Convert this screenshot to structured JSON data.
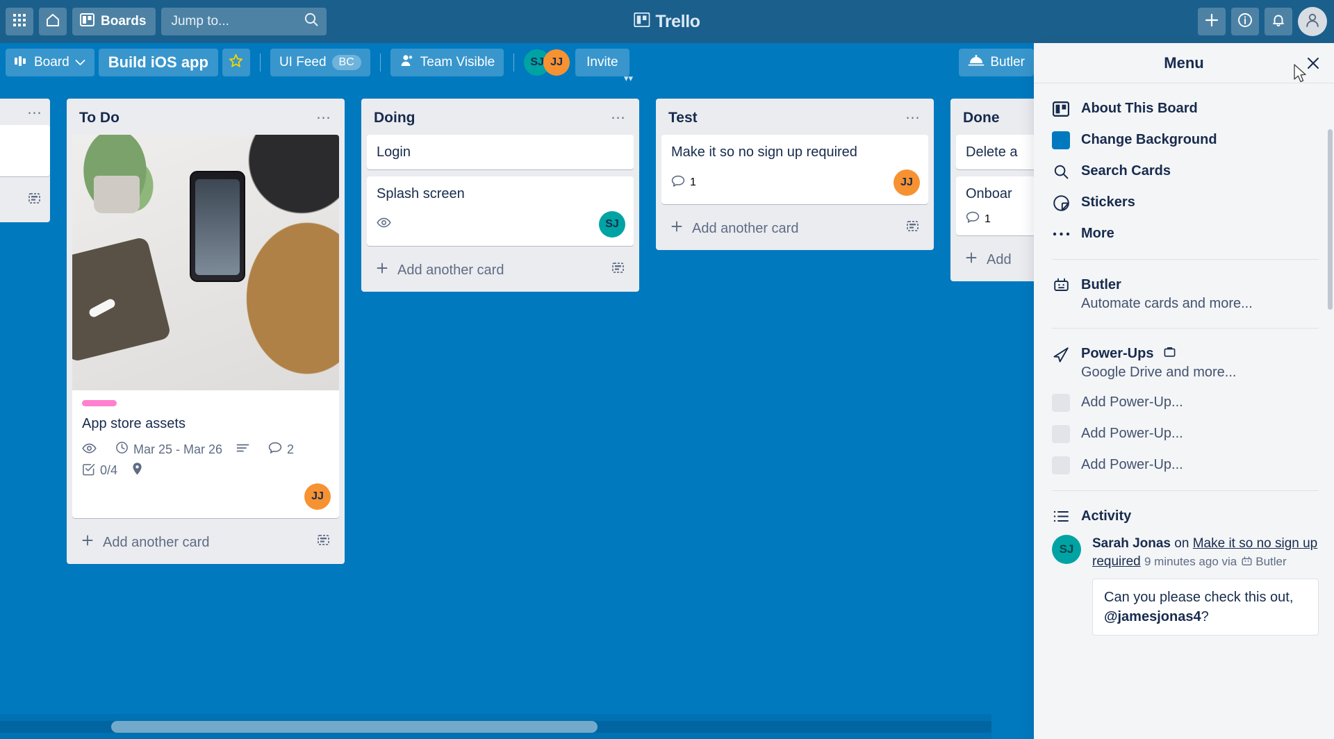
{
  "topnav": {
    "apps_icon": "grid-apps-icon",
    "home_icon": "home-icon",
    "boards_label": "Boards",
    "boards_icon": "board-icon",
    "search_placeholder": "Jump to...",
    "search_icon": "search-icon",
    "logo_text": "Trello",
    "logo_icon": "trello-logo-icon",
    "add_icon": "plus-icon",
    "info_icon": "info-icon",
    "notifications_icon": "bell-icon",
    "account_icon": "user-avatar-icon"
  },
  "boardbar": {
    "board_view_label": "Board",
    "board_view_icon": "board-view-icon",
    "chevron_icon": "chevron-down-icon",
    "board_title": "Build iOS app",
    "star_icon": "star-icon",
    "team_name": "UI Feed",
    "team_badge": "BC",
    "visibility_label": "Team Visible",
    "visibility_icon": "person-icon",
    "members": [
      {
        "initials": "SJ",
        "color": "#00a3a3"
      },
      {
        "initials": "JJ",
        "color": "#f79232"
      }
    ],
    "invite_label": "Invite",
    "butler_label": "Butler",
    "butler_icon": "butler-cloche-icon"
  },
  "lists": [
    {
      "title": "",
      "partial": "left",
      "cards": [
        {
          "title": ""
        }
      ],
      "add_card_label": "",
      "template_icon": "card-template-icon",
      "dots_icon": "list-actions-icon"
    },
    {
      "title": "To Do",
      "dots_icon": "list-actions-icon",
      "cards": [
        {
          "cover": "app-store-assets-photo",
          "labels": [
            {
              "color": "#ff80ce"
            }
          ],
          "title": "App store assets",
          "badges": [
            {
              "icon": "eye-icon",
              "text": ""
            },
            {
              "icon": "clock-icon",
              "text": "Mar 25 - Mar 26"
            },
            {
              "icon": "description-icon",
              "text": ""
            },
            {
              "icon": "comment-icon",
              "text": "2"
            },
            {
              "icon": "checklist-icon",
              "text": "0/4"
            },
            {
              "icon": "location-pin-icon",
              "text": ""
            }
          ],
          "members": [
            {
              "initials": "JJ",
              "color": "#f79232"
            }
          ]
        }
      ],
      "add_card_label": "Add another card",
      "add_card_icon": "plus-icon",
      "template_icon": "card-template-icon"
    },
    {
      "title": "Doing",
      "dots_icon": "list-actions-icon",
      "cards": [
        {
          "title": "Login",
          "badges": [],
          "members": []
        },
        {
          "title": "Splash screen",
          "badges": [
            {
              "icon": "eye-icon",
              "text": ""
            }
          ],
          "members": [
            {
              "initials": "SJ",
              "color": "#00a3a3"
            }
          ]
        }
      ],
      "add_card_label": "Add another card",
      "add_card_icon": "plus-icon",
      "template_icon": "card-template-icon"
    },
    {
      "title": "Test",
      "dots_icon": "list-actions-icon",
      "cards": [
        {
          "title": "Make it so no sign up required",
          "badges": [
            {
              "icon": "comment-icon",
              "text": "1"
            }
          ],
          "members": [
            {
              "initials": "JJ",
              "color": "#f79232"
            }
          ]
        }
      ],
      "add_card_label": "Add another card",
      "add_card_icon": "plus-icon",
      "template_icon": "card-template-icon"
    },
    {
      "title": "Done",
      "partial": "right",
      "dots_icon": "list-actions-icon",
      "cards": [
        {
          "title": "Delete a",
          "badges": [],
          "members": []
        },
        {
          "title": "Onboar",
          "badges": [
            {
              "icon": "comment-icon",
              "text": "1"
            }
          ],
          "members": []
        }
      ],
      "add_card_label": "Add",
      "add_card_icon": "plus-icon",
      "template_icon": "card-template-icon"
    }
  ],
  "menu": {
    "title": "Menu",
    "close_icon": "close-icon",
    "items": [
      {
        "label": "About This Board",
        "icon": "board-icon"
      },
      {
        "label": "Change Background",
        "icon": "background-swatch-icon"
      },
      {
        "label": "Search Cards",
        "icon": "search-icon"
      },
      {
        "label": "Stickers",
        "icon": "sticker-icon"
      },
      {
        "label": "More",
        "icon": "ellipsis-icon"
      }
    ],
    "butler": {
      "label": "Butler",
      "sub": "Automate cards and more...",
      "icon": "butler-robot-icon"
    },
    "powerups": {
      "label": "Power-Ups",
      "badge_icon": "briefcase-icon",
      "sub": "Google Drive and more...",
      "icon": "rocket-icon",
      "slots": [
        {
          "label": "Add Power-Up...",
          "icon": "empty-swatch-icon"
        },
        {
          "label": "Add Power-Up...",
          "icon": "empty-swatch-icon"
        },
        {
          "label": "Add Power-Up...",
          "icon": "empty-swatch-icon"
        }
      ]
    },
    "activity": {
      "label": "Activity",
      "icon": "activity-list-icon",
      "entry": {
        "avatar_initials": "SJ",
        "avatar_color": "#00a3a3",
        "actor": "Sarah Jonas",
        "connector": "on",
        "card": "Make it so no sign up required",
        "time": "9 minutes ago via",
        "via_icon": "butler-robot-icon",
        "via": "Butler",
        "comment_prefix": "Can you please check this out, ",
        "comment_mention": "@jamesjonas4",
        "comment_suffix": "?"
      }
    }
  },
  "scrollbar": {
    "name": "horizontal-board-scrollbar"
  },
  "colors": {
    "board_background": "#0079bf",
    "topnav": "#1b5f8c",
    "list_background": "#ebecf0",
    "menu_background": "#f4f5f7",
    "label_pink": "#ff80ce",
    "avatar_teal": "#00a3a3",
    "avatar_orange": "#f79232"
  }
}
